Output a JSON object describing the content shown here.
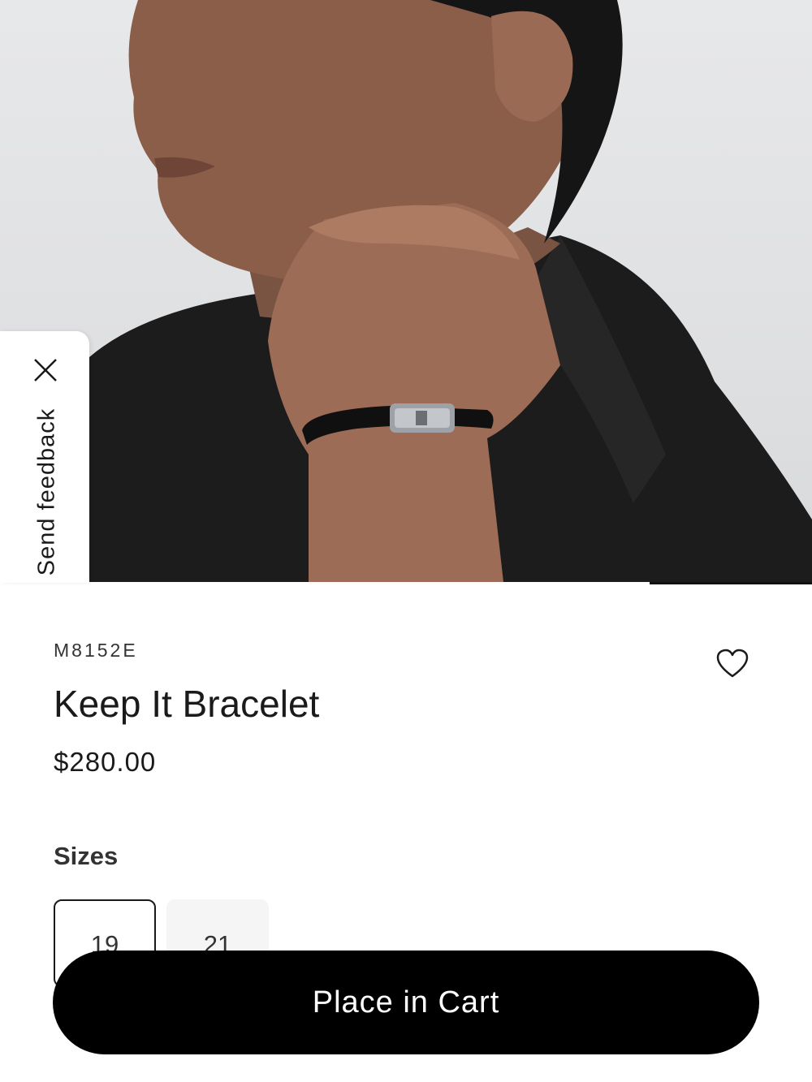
{
  "feedback": {
    "label": "Send feedback",
    "close_icon": "close-icon"
  },
  "product": {
    "sku": "M8152E",
    "name": "Keep It Bracelet",
    "price": "$280.00",
    "wishlist_icon": "heart-icon",
    "image": "model-wearing-bracelet-photo"
  },
  "sizes": {
    "label": "Sizes",
    "options": [
      {
        "label": "19",
        "selected": true
      },
      {
        "label": "21",
        "selected": false
      }
    ]
  },
  "cta": {
    "label": "Place in Cart"
  },
  "colors": {
    "button": "#000000",
    "button_text": "#ffffff",
    "selected_border": "#1a1a1a"
  }
}
